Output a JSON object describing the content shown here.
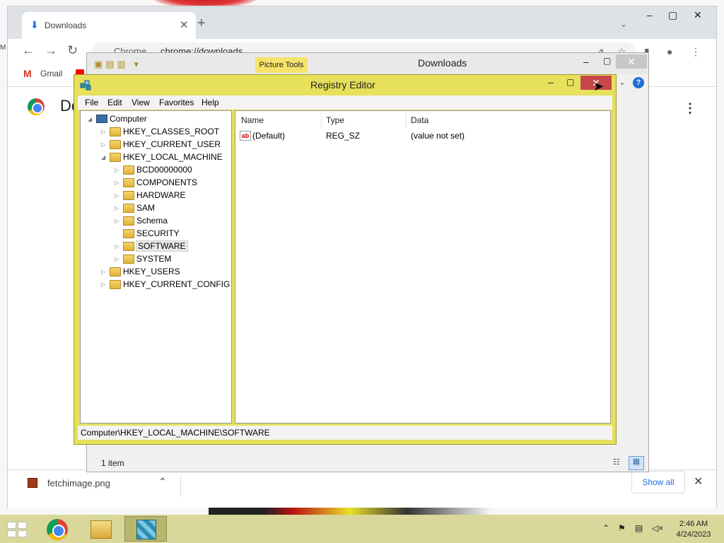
{
  "chrome": {
    "tab_title": "Downloads",
    "new_tab_glyph": "+",
    "omnibox_label": "Chrome",
    "omnibox_url": "chrome://downloads",
    "bookmark_gmail": "Gmail",
    "page_title": "Do",
    "shelf_file": "fetchimage.png",
    "show_all": "Show all"
  },
  "explorer": {
    "title": "Downloads",
    "picture_tools": "Picture Tools",
    "status": "1 item"
  },
  "regedit": {
    "title": "Registry Editor",
    "menu": [
      "File",
      "Edit",
      "View",
      "Favorites",
      "Help"
    ],
    "tree": [
      {
        "label": "Computer",
        "arrow": "◢",
        "kind": "pc"
      },
      {
        "label": "HKEY_CLASSES_ROOT",
        "arrow": "▷",
        "kind": "folder"
      },
      {
        "label": "HKEY_CURRENT_USER",
        "arrow": "▷",
        "kind": "folder"
      },
      {
        "label": "HKEY_LOCAL_MACHINE",
        "arrow": "◢",
        "kind": "folder"
      },
      {
        "label": "BCD00000000",
        "arrow": "▷",
        "kind": "folder"
      },
      {
        "label": "COMPONENTS",
        "arrow": "▷",
        "kind": "folder"
      },
      {
        "label": "HARDWARE",
        "arrow": "▷",
        "kind": "folder"
      },
      {
        "label": "SAM",
        "arrow": "▷",
        "kind": "folder"
      },
      {
        "label": "Schema",
        "arrow": "▷",
        "kind": "folder"
      },
      {
        "label": "SECURITY",
        "arrow": "",
        "kind": "folder"
      },
      {
        "label": "SOFTWARE",
        "arrow": "▷",
        "kind": "folder",
        "selected": true
      },
      {
        "label": "SYSTEM",
        "arrow": "▷",
        "kind": "folder"
      },
      {
        "label": "HKEY_USERS",
        "arrow": "▷",
        "kind": "folder"
      },
      {
        "label": "HKEY_CURRENT_CONFIG",
        "arrow": "▷",
        "kind": "folder"
      }
    ],
    "columns": [
      "Name",
      "Type",
      "Data"
    ],
    "values": [
      {
        "name": "(Default)",
        "type": "REG_SZ",
        "data": "(value not set)",
        "icon": "ab"
      }
    ],
    "status_path": "Computer\\HKEY_LOCAL_MACHINE\\SOFTWARE"
  },
  "taskbar": {
    "apps": [
      "chrome-icon",
      "file-explorer-icon",
      "registry-editor-icon"
    ],
    "time": "2:46 AM",
    "date": "4/24/2023"
  },
  "colors": {
    "regedit_frame": "#e6e05a",
    "close_red": "#c7464a",
    "taskbar": "#d9d79a"
  }
}
